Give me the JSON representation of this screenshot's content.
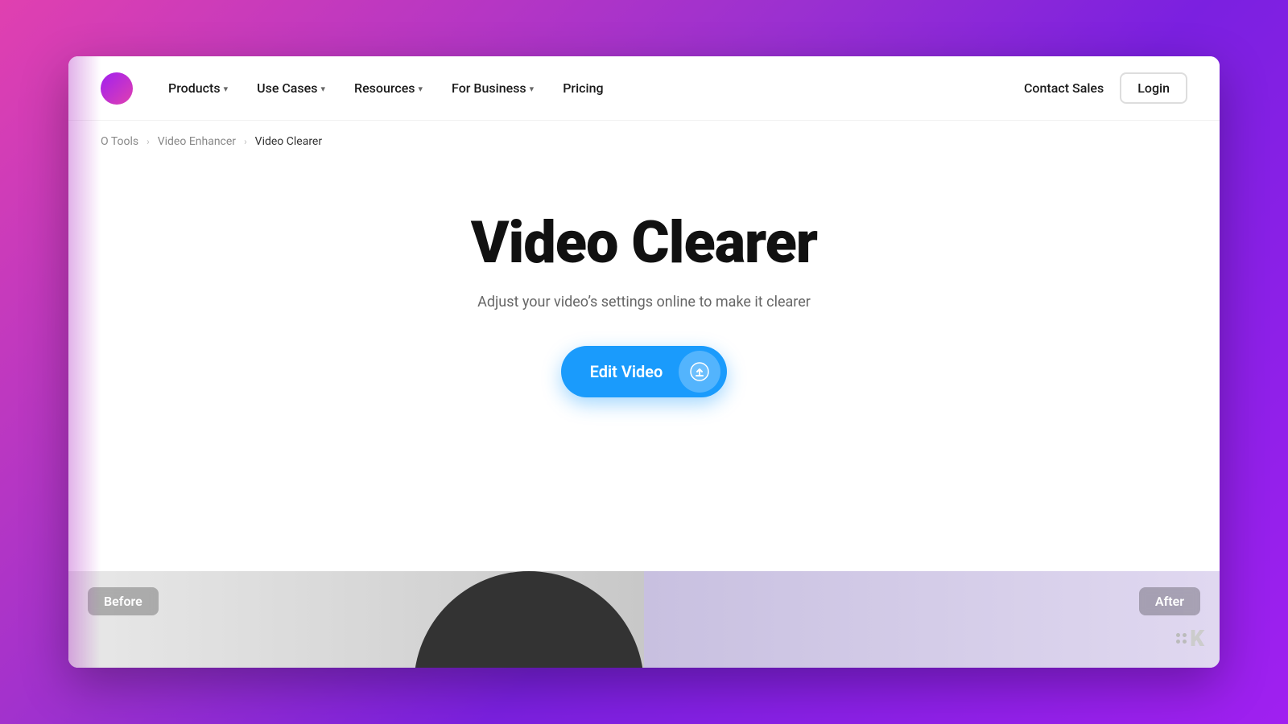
{
  "page": {
    "title": "Video Clearer"
  },
  "navbar": {
    "logo_alt": "Kapwing Logo",
    "nav_items": [
      {
        "label": "Products",
        "has_dropdown": true
      },
      {
        "label": "Use Cases",
        "has_dropdown": true
      },
      {
        "label": "Resources",
        "has_dropdown": true
      },
      {
        "label": "For Business",
        "has_dropdown": true
      },
      {
        "label": "Pricing",
        "has_dropdown": false
      }
    ],
    "contact_sales_label": "Contact Sales",
    "login_label": "Login"
  },
  "breadcrumb": {
    "items": [
      {
        "label": "O Tools",
        "active": false
      },
      {
        "label": "Video Enhancer",
        "active": false
      },
      {
        "label": "Video Clearer",
        "active": true
      }
    ]
  },
  "hero": {
    "title": "Video Clearer",
    "subtitle": "Adjust your video’s settings online to make it clearer",
    "cta_label": "Edit Video",
    "cta_icon": "↑"
  },
  "before_after": {
    "before_label": "Before",
    "after_label": "After"
  },
  "watermark": {
    "text": "K"
  },
  "colors": {
    "cta_blue": "#1a9bfc",
    "body_bg_from": "#e040b0",
    "body_bg_to": "#a020f0",
    "nav_bg": "#ffffff",
    "title_color": "#111111",
    "subtitle_color": "#666666"
  }
}
